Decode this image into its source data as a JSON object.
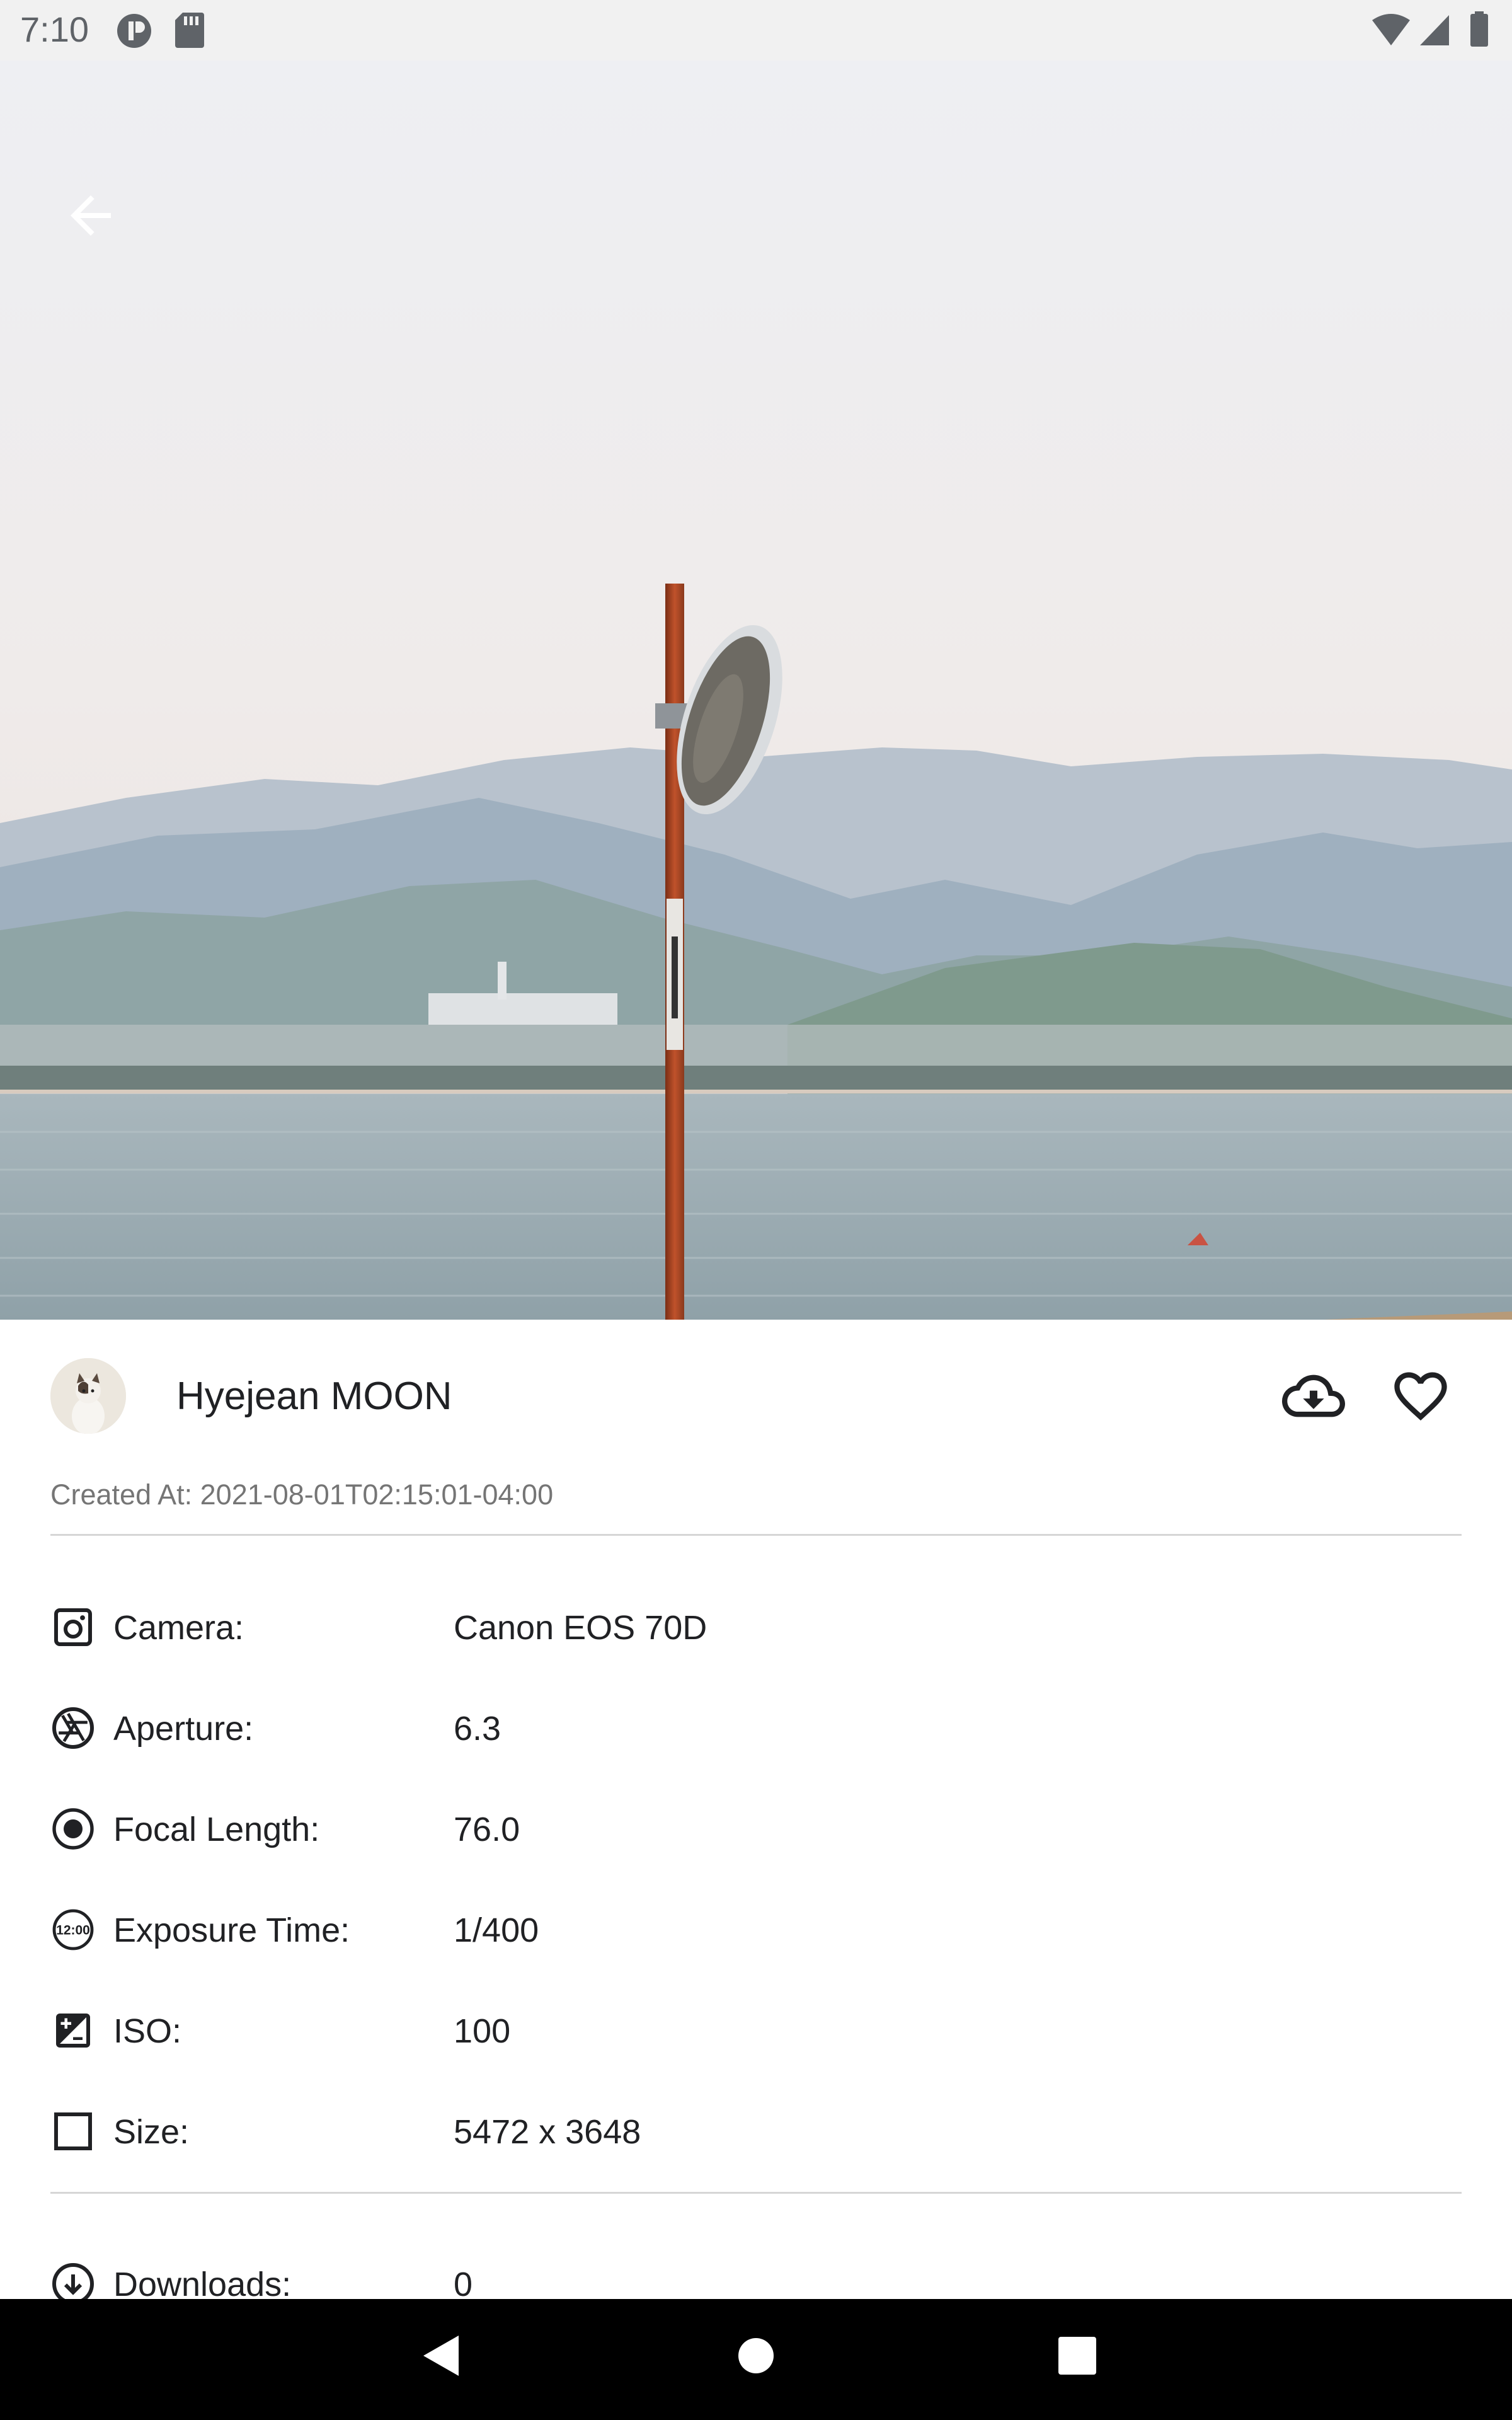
{
  "status_bar": {
    "time": "7:10"
  },
  "author": {
    "name": "Hyejean MOON"
  },
  "created_at": {
    "label": "Created At:",
    "value": "2021-08-01T02:15:01-04:00"
  },
  "info": [
    {
      "icon": "camera-icon",
      "label": "Camera:",
      "value": "Canon EOS 70D"
    },
    {
      "icon": "aperture-icon",
      "label": "Aperture:",
      "value": "6.3"
    },
    {
      "icon": "focal-length-icon",
      "label": "Focal Length:",
      "value": "76.0"
    },
    {
      "icon": "exposure-time-icon",
      "label": "Exposure Time:",
      "value": "1/400"
    },
    {
      "icon": "iso-icon",
      "label": "ISO:",
      "value": "100"
    },
    {
      "icon": "size-icon",
      "label": "Size:",
      "value": "5472 x 3648"
    }
  ],
  "stats": [
    {
      "icon": "download-icon",
      "label": "Downloads:",
      "value": "0"
    }
  ]
}
